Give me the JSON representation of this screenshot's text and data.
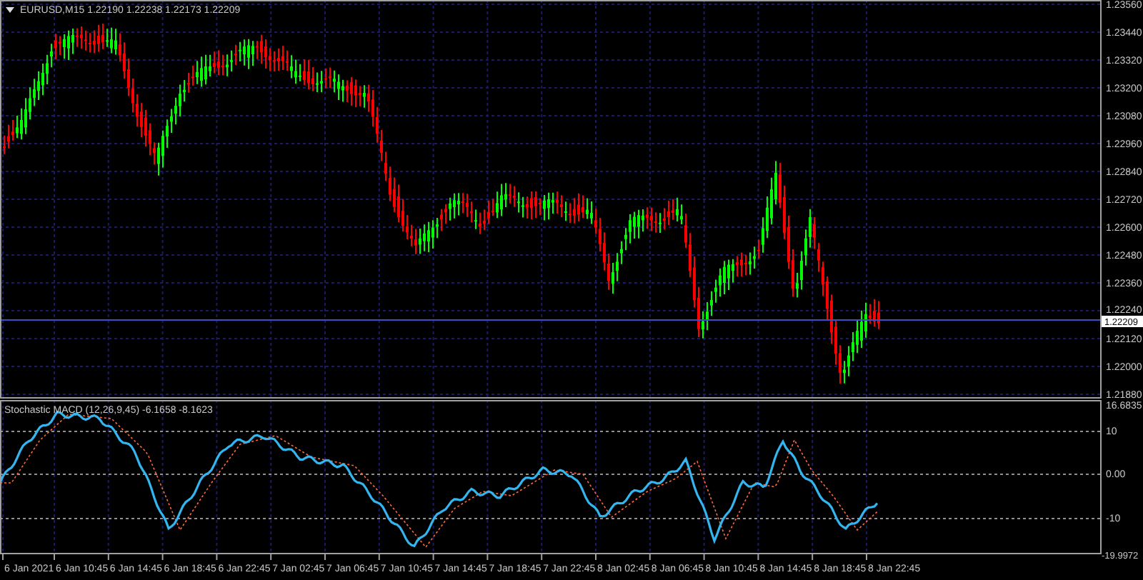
{
  "chart": {
    "symbol": "EURUSD,M15",
    "ohlc": [
      "1.22190",
      "1.22238",
      "1.22173",
      "1.22209"
    ],
    "current_price": "1.22209",
    "price_ticks": [
      "1.23560",
      "1.23440",
      "1.23320",
      "1.23200",
      "1.23080",
      "1.22960",
      "1.22840",
      "1.22720",
      "1.22600",
      "1.22480",
      "1.22360",
      "1.22240",
      "1.22120",
      "1.22000",
      "1.21880"
    ]
  },
  "indicator": {
    "name": "Stochastic MACD (12,26,9,45)",
    "values": [
      "-6.1658",
      "-8.1623"
    ],
    "ticks": [
      "16.6835",
      "10",
      "0.00",
      "-10",
      "-19.9972"
    ]
  },
  "time_axis": {
    "labels": [
      "6 Jan 2021",
      "6 Jan 10:45",
      "6 Jan 14:45",
      "6 Jan 18:45",
      "6 Jan 22:45",
      "7 Jan 02:45",
      "7 Jan 06:45",
      "7 Jan 10:45",
      "7 Jan 14:45",
      "7 Jan 18:45",
      "7 Jan 22:45",
      "8 Jan 02:45",
      "8 Jan 06:45",
      "8 Jan 10:45",
      "8 Jan 14:45",
      "8 Jan 18:45",
      "8 Jan 22:45"
    ]
  }
}
